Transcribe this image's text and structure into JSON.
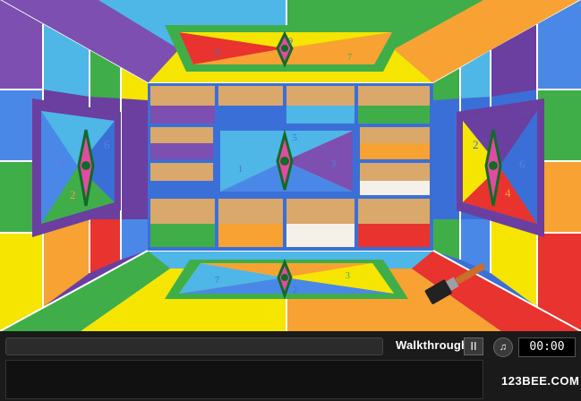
{
  "hud": {
    "walkthrough_label": "Walkthrough",
    "pause_glyph": "II",
    "sound_icon": "speaker-icon",
    "timer": "00:00",
    "logo_text": "123BEE.COM"
  },
  "puzzles": {
    "ceiling": {
      "numbers": [
        "4",
        "7",
        "9"
      ]
    },
    "left_wall": {
      "numbers": [
        "4",
        "6",
        "2"
      ]
    },
    "back_wall": {
      "numbers": [
        "5",
        "1",
        "3"
      ]
    },
    "right_wall": {
      "numbers": [
        "2",
        "6",
        "4"
      ]
    },
    "floor": {
      "numbers": [
        "7",
        "2",
        "3"
      ]
    }
  },
  "items": {
    "paintbrush": "paintbrush-icon"
  },
  "colors": {
    "red": "#e8332e",
    "orange": "#f7a233",
    "yellow": "#f6e500",
    "green": "#3fae49",
    "blue": "#3b6fd8",
    "purple": "#7d4fb0",
    "frame_green": "#37a842",
    "frame_purple": "#6a3fa0"
  }
}
